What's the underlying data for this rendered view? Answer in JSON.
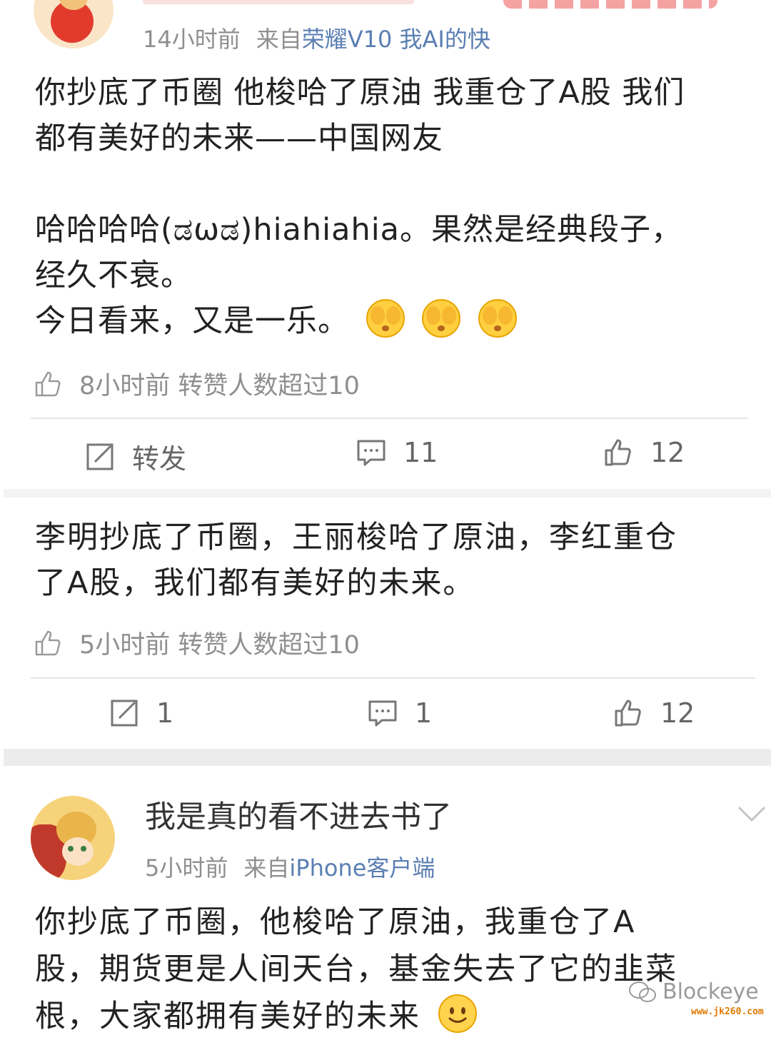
{
  "post1": {
    "time": "14小时前",
    "from_prefix": "来自",
    "source": "荣耀V10 我AI的快",
    "text_lines": [
      "你抄底了币圈 他梭哈了原油 我重仓了A股 我们",
      "都有美好的未来——中国网友",
      "",
      "哈哈哈哈(ಡωಡ)hiahiahia。果然是经典段子，",
      "经久不衰。",
      "今日看来，又是一乐。"
    ],
    "meta": "8小时前 转赞人数超过10",
    "repost_label": "转发",
    "comment_count": "11",
    "like_count": "12"
  },
  "post2": {
    "text_lines": [
      "李明抄底了币圈，王丽梭哈了原油，李红重仓",
      "了A股，我们都有美好的未来。"
    ],
    "meta": "5小时前 转赞人数超过10",
    "repost_count": "1",
    "comment_count": "1",
    "like_count": "12"
  },
  "post3": {
    "username": "我是真的看不进去书了",
    "time": "5小时前",
    "from_prefix": "来自",
    "source": "iPhone客户端",
    "text_lines": [
      "你抄底了币圈，他梭哈了原油，我重仓了A",
      "股，期货更是人间天台，基金失去了它的韭菜",
      "根，大家都拥有美好的未来"
    ]
  },
  "watermark": {
    "brand": "Blockeye",
    "site": "www.jk260.com"
  },
  "colors": {
    "source_link": "#5b7fb3",
    "meta_gray": "#8f8f8f",
    "divider": "#e6e6e6"
  }
}
